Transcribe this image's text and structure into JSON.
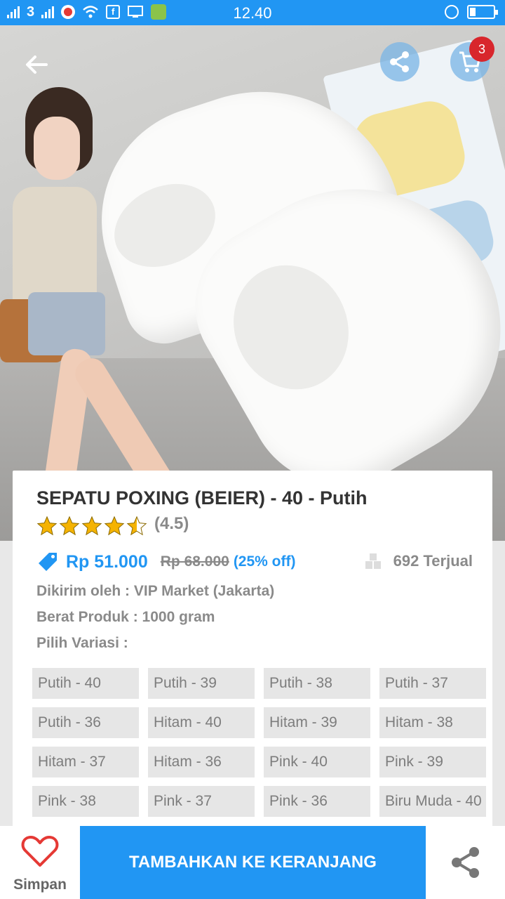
{
  "status_bar": {
    "time": "12.40",
    "carrier_glyph": "3"
  },
  "header": {
    "cart_count": "3"
  },
  "product": {
    "title": "SEPATU POXING (BEIER) - 40 - Putih",
    "rating": 4.5,
    "rating_label": "(4.5)",
    "price": "Rp 51.000",
    "old_price": "Rp 68.000",
    "discount": "(25% off)",
    "sold": "692 Terjual",
    "shipped_by": "Dikirim oleh : VIP Market (Jakarta)",
    "weight": "Berat Produk : 1000 gram",
    "variant_prompt": "Pilih Variasi :",
    "variants": [
      "Putih - 40",
      "Putih - 39",
      "Putih - 38",
      "Putih - 37",
      "Putih - 36",
      "Hitam - 40",
      "Hitam - 39",
      "Hitam - 38",
      "Hitam - 37",
      "Hitam - 36",
      "Pink - 40",
      "Pink - 39",
      "Pink - 38",
      "Pink - 37",
      "Pink - 36",
      "Biru Muda - 40"
    ]
  },
  "bottom_bar": {
    "save_label": "Simpan",
    "add_to_cart_label": "TAMBAHKAN KE KERANJANG"
  },
  "colors": {
    "primary": "#2196f3",
    "star": "#f5b301",
    "badge": "#d8262c",
    "heart": "#e53935"
  }
}
